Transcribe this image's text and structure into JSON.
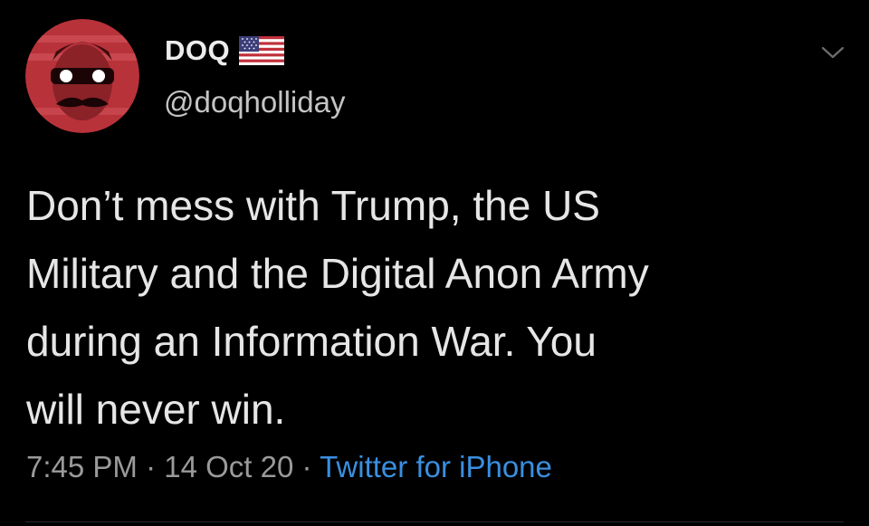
{
  "tweet": {
    "display_name": "DOQ",
    "handle": "@doqholliday",
    "text_lines": [
      "Don’t mess with Trump, the US",
      "Military and the Digital Anon Army",
      "during an Information War. You",
      "will never win."
    ],
    "time": "7:45 PM",
    "separator": "·",
    "date": "14 Oct 20",
    "source": "Twitter for iPhone"
  },
  "icons": {
    "avatar": "avatar-image",
    "flag": "us-flag-icon",
    "menu": "chevron-down-icon"
  },
  "colors": {
    "background": "#000000",
    "text": "#e6e6e6",
    "muted": "#9a9a9a",
    "link": "#3a8fe0",
    "avatar_bg": "#c0393b"
  }
}
